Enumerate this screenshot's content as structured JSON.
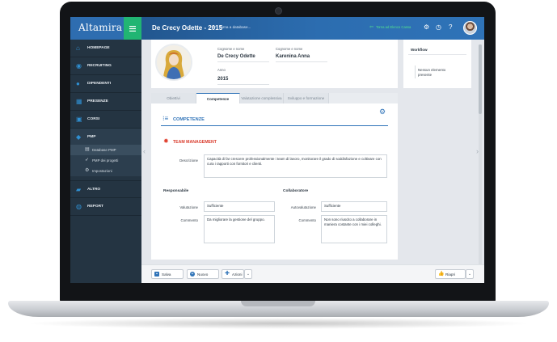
{
  "app": {
    "logo": "Altamira",
    "page_title": "De Crecy Odette - 2015",
    "breadcrumb": "Torna a database...",
    "green_link": "Torna ad Elenco Cassa"
  },
  "icons": {
    "menu": "hamburger-icon",
    "gear": "gear-icon",
    "clock": "clock-icon",
    "help": "help-icon"
  },
  "colors": {
    "accent": "#2f73b8",
    "green": "#21b573",
    "sidebar": "#243442",
    "team_red": "#d93a2b"
  },
  "sidebar": {
    "items": [
      {
        "label": "HOMEPAGE",
        "icon": "home-icon"
      },
      {
        "label": "RECRUITING",
        "icon": "recruiting-icon"
      },
      {
        "label": "DIPENDENTI",
        "icon": "users-icon"
      },
      {
        "label": "PRESENZE",
        "icon": "calendar-icon"
      },
      {
        "label": "CORSI",
        "icon": "courses-icon"
      },
      {
        "label": "PMP",
        "icon": "pmp-icon"
      },
      {
        "label": "ALTRO",
        "icon": "folder-icon"
      },
      {
        "label": "REPORT",
        "icon": "report-icon"
      }
    ],
    "subitems": [
      {
        "label": "Database PMP",
        "icon": "database-icon"
      },
      {
        "label": "PMP dei progetti",
        "icon": "rocket-icon"
      },
      {
        "label": "Impostazioni",
        "icon": "settings-icon"
      }
    ]
  },
  "profile": {
    "cognome_label": "Cognome e nome",
    "cognome_value": "De Crecy Odette",
    "cognome2_label": "Cognome e nome",
    "cognome2_value": "Karenina Anna",
    "anno_label": "Anno",
    "anno_value": "2015"
  },
  "tabs": [
    {
      "label": "Obiettivi"
    },
    {
      "label": "Competenze"
    },
    {
      "label": "Valutazione complessiva"
    },
    {
      "label": "Sviluppo e formazione"
    }
  ],
  "section": {
    "title": "COMPETENZE"
  },
  "team": {
    "title": "TEAM MANAGEMENT",
    "descr_label": "Descrizione",
    "descr_value": "Capacità di far crescere professionalmente i team di lavoro, monitorare il grado di soddisfazione e coltivare con cura i rapporti con fornitori e clienti.",
    "resp_head": "Responsabile",
    "coll_head": "Collaboratore",
    "val_label": "Valutazione",
    "val_value": "Sufficiente",
    "autoval_label": "Autovalutazione",
    "autoval_value": "Sufficiente",
    "comm_label": "Commento",
    "comm_value": "Da migliorare la gestione del gruppo.",
    "comm2_label": "Commento",
    "comm2_value": "Non sono riuscito a collaborare in maniera costante con i miei colleghi."
  },
  "workflow": {
    "title": "Workflow",
    "text": "Nessun elemento presente"
  },
  "toolbar": {
    "salva": "Salva",
    "nuovo": "Nuovo",
    "azioni": "Azioni",
    "riapri": "Riapri"
  }
}
